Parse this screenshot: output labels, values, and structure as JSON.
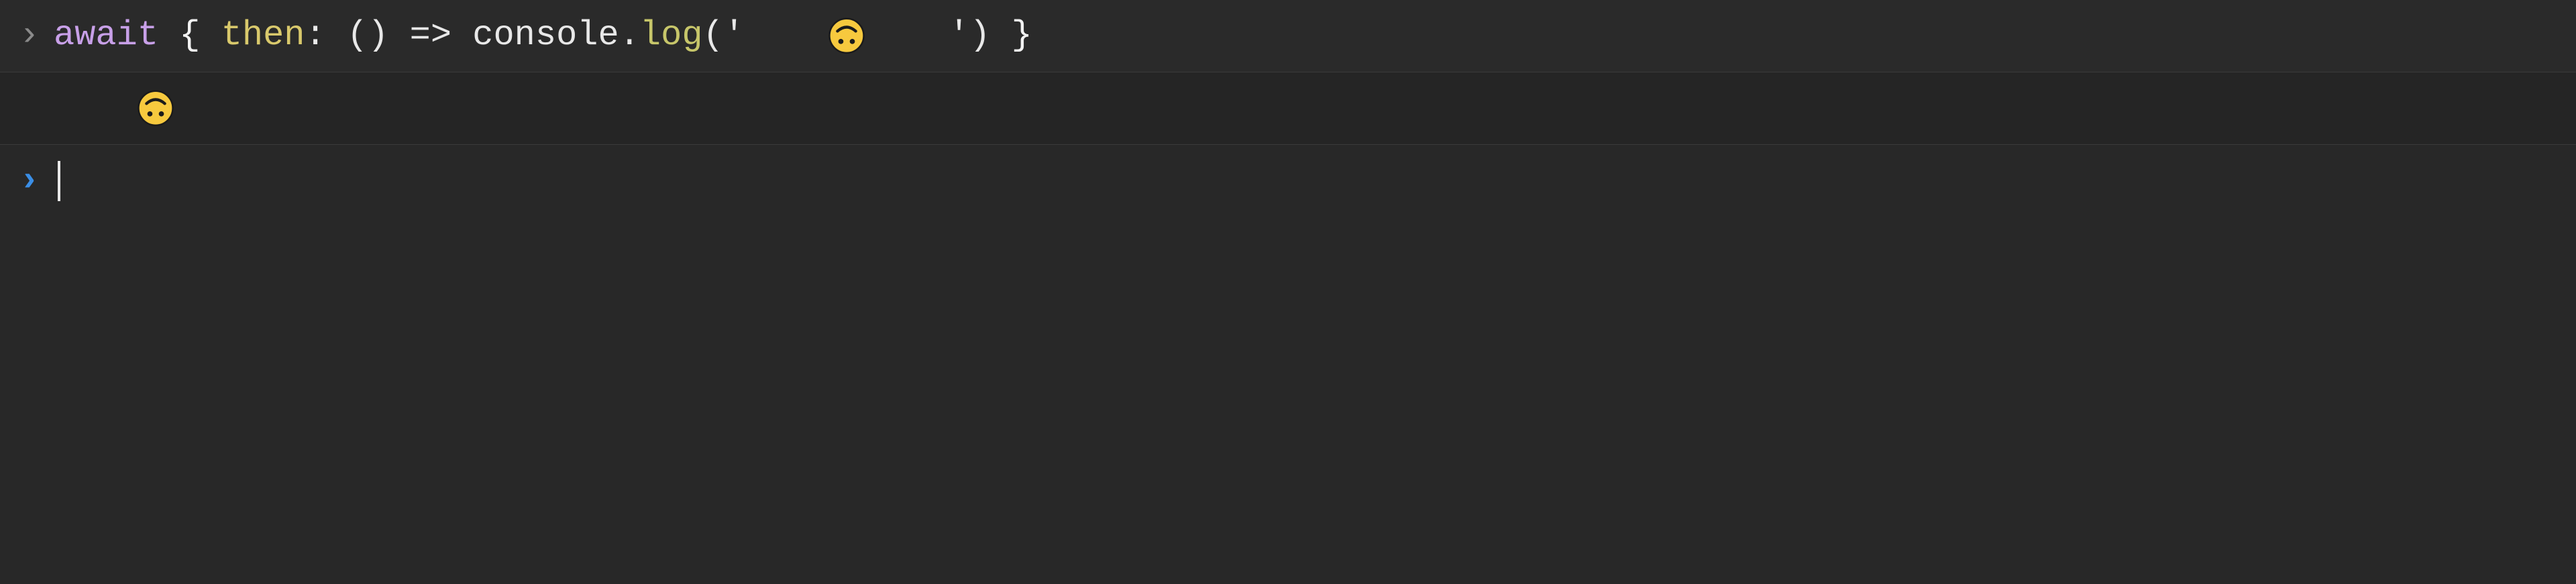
{
  "console": {
    "entries": [
      {
        "kind": "input-past",
        "tokens": {
          "await": "await",
          "space": " ",
          "lbrace": "{",
          "then": "then",
          "colon": ":",
          "lparen": "(",
          "rparen": ")",
          "arrow": "=>",
          "consoleIdent": "console",
          "dot": ".",
          "log": "log",
          "callL": "(",
          "quote1": "'",
          "emoji": "🙃",
          "quote2": "'",
          "callR": ")",
          "rbrace": "}"
        }
      },
      {
        "kind": "output",
        "value": "🙃"
      },
      {
        "kind": "input-current",
        "value": ""
      }
    ]
  },
  "icons": {
    "chevron_past": "›",
    "chevron_current": "›"
  }
}
